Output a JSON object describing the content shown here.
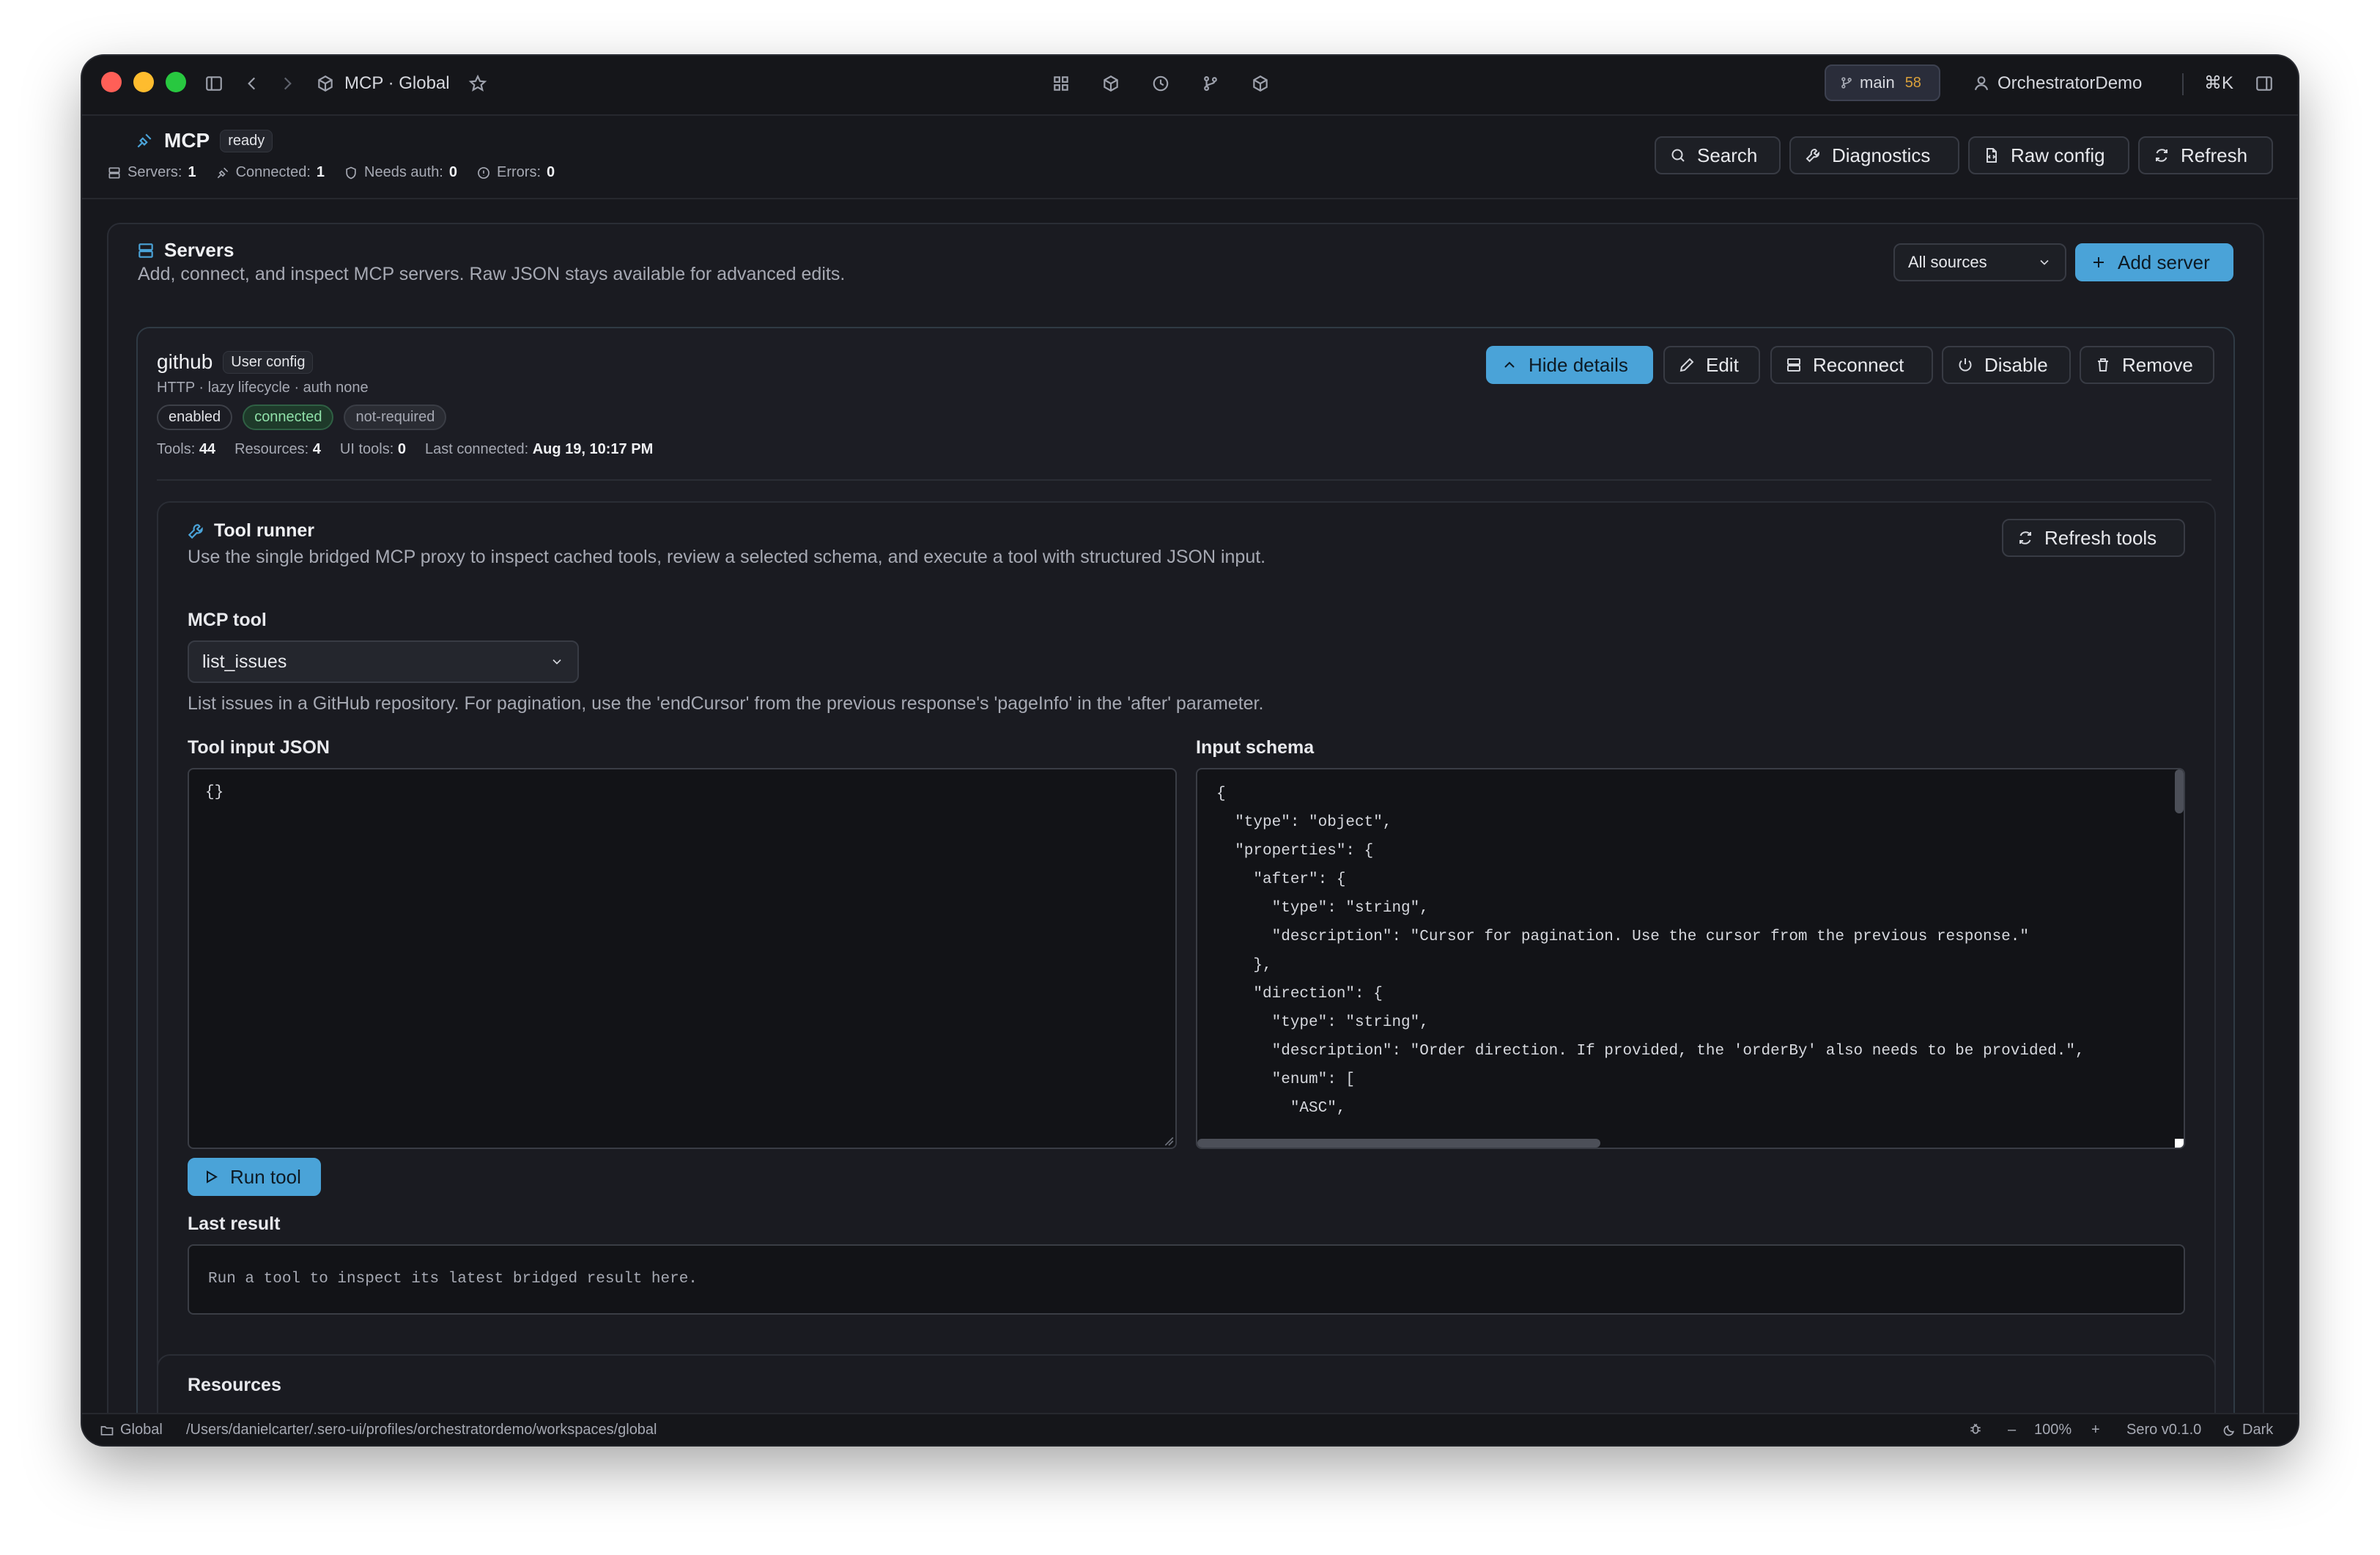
{
  "titlebar": {
    "title": "MCP · Global",
    "branch": "main",
    "branch_count": "58",
    "user": "OrchestratorDemo",
    "shortcut": "⌘K"
  },
  "header": {
    "title": "MCP",
    "status": "ready",
    "stats": [
      {
        "label": "Servers:",
        "value": "1"
      },
      {
        "label": "Connected:",
        "value": "1"
      },
      {
        "label": "Needs auth:",
        "value": "0"
      },
      {
        "label": "Errors:",
        "value": "0"
      }
    ],
    "buttons": {
      "search": "Search",
      "diagnostics": "Diagnostics",
      "raw_config": "Raw config",
      "refresh": "Refresh"
    }
  },
  "servers": {
    "title": "Servers",
    "description": "Add, connect, and inspect MCP servers. Raw JSON stays available for advanced edits.",
    "filter_value": "All sources",
    "add_label": "Add server"
  },
  "server": {
    "name": "github",
    "source": "User config",
    "meta": "HTTP · lazy lifecycle · auth none",
    "tags": [
      "enabled",
      "connected",
      "not-required"
    ],
    "counts": [
      {
        "label": "Tools:",
        "value": "44"
      },
      {
        "label": "Resources:",
        "value": "4"
      },
      {
        "label": "UI tools:",
        "value": "0"
      },
      {
        "label": "Last connected:",
        "value": "Aug 19, 10:17 PM"
      }
    ],
    "buttons": {
      "hide": "Hide details",
      "edit": "Edit",
      "reconnect": "Reconnect",
      "disable": "Disable",
      "remove": "Remove"
    }
  },
  "runner": {
    "title": "Tool runner",
    "description": "Use the single bridged MCP proxy to inspect cached tools, review a selected schema, and execute a tool with structured JSON input.",
    "refresh_label": "Refresh tools",
    "tool_label": "MCP tool",
    "tool_value": "list_issues",
    "tool_description": "List issues in a GitHub repository. For pagination, use the 'endCursor' from the previous response's 'pageInfo' in the 'after' parameter.",
    "input_label": "Tool input JSON",
    "input_value": "{}",
    "schema_label": "Input schema",
    "schema_lines": [
      "{",
      "  \"type\": \"object\",",
      "  \"properties\": {",
      "    \"after\": {",
      "      \"type\": \"string\",",
      "      \"description\": \"Cursor for pagination. Use the cursor from the previous response.\"",
      "    },",
      "    \"direction\": {",
      "      \"type\": \"string\",",
      "      \"description\": \"Order direction. If provided, the 'orderBy' also needs to be provided.\",",
      "      \"enum\": [",
      "        \"ASC\","
    ],
    "run_label": "Run tool",
    "result_label": "Last result",
    "result_placeholder": "Run a tool to inspect its latest bridged result here."
  },
  "resources": {
    "title": "Resources"
  },
  "statusbar": {
    "workspace": "Global",
    "path": "/Users/danielcarter/.sero-ui/profiles/orchestratordemo/workspaces/global",
    "zoom_minus": "–",
    "zoom": "100%",
    "zoom_plus": "+",
    "version": "Sero v0.1.0",
    "theme": "Dark"
  },
  "colors": {
    "accent": "#4aa3d8",
    "background": "#17181d",
    "ok": "#8fe0a8",
    "branch_count": "#d9a03a"
  }
}
